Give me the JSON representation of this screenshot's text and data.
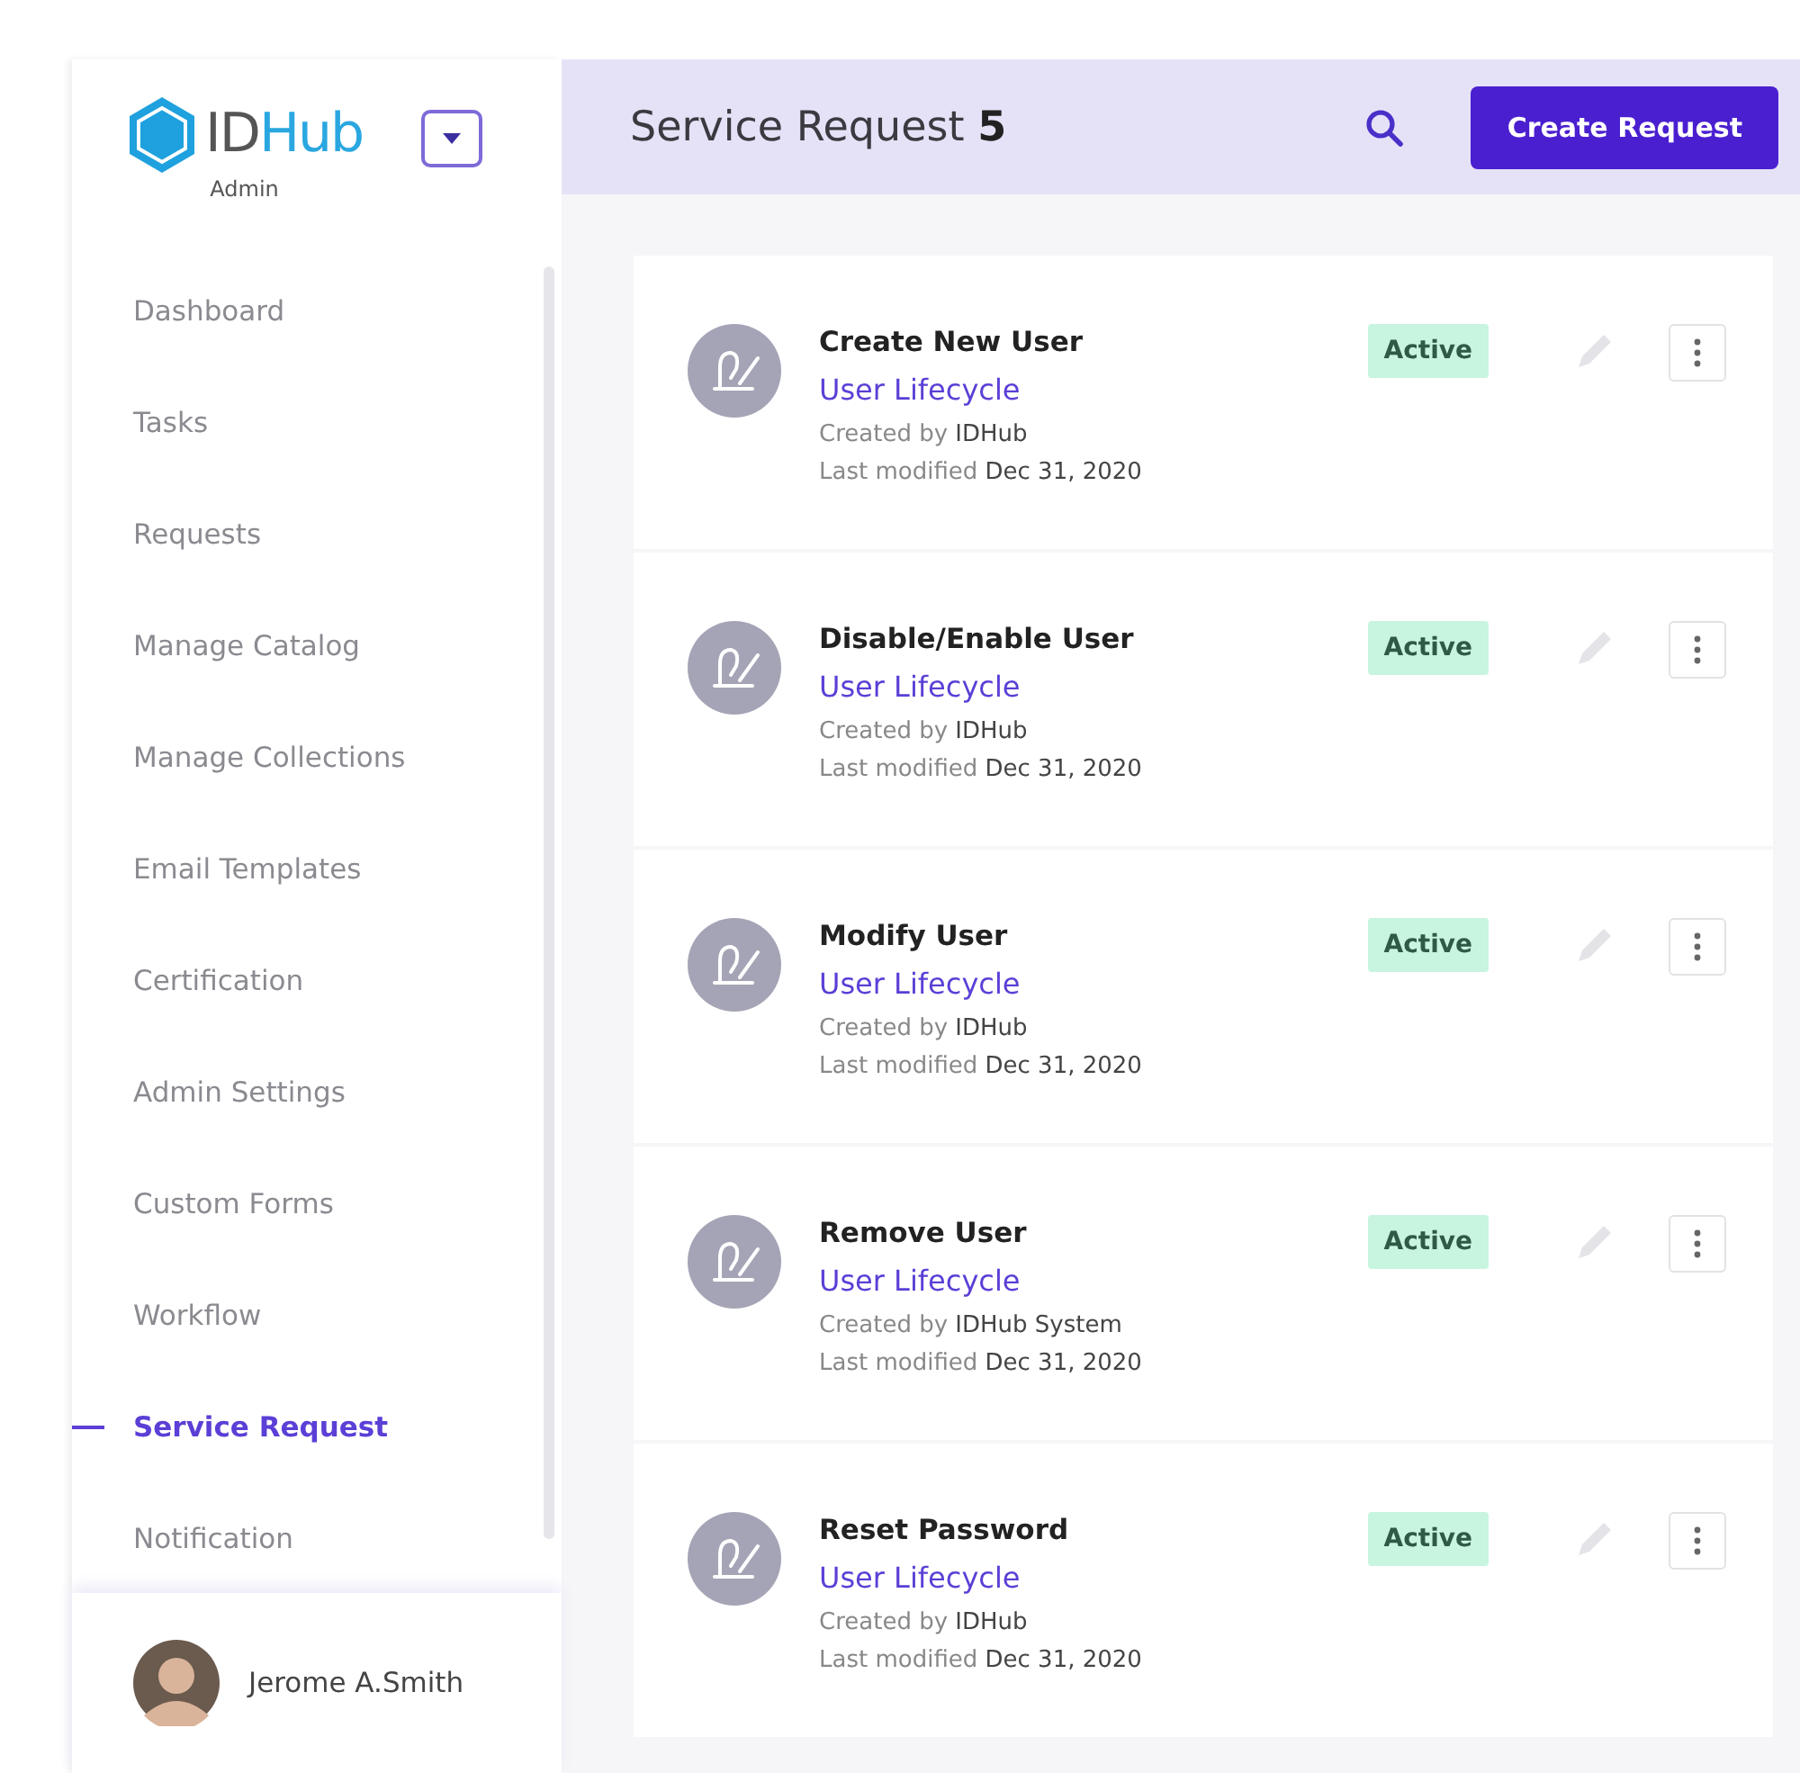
{
  "brand": {
    "name_dark": "ID",
    "name_light": "Hub",
    "subtitle": "Admin"
  },
  "sidebar": {
    "items": [
      {
        "label": "Dashboard",
        "selected": false
      },
      {
        "label": "Tasks",
        "selected": false
      },
      {
        "label": "Requests",
        "selected": false
      },
      {
        "label": "Manage Catalog",
        "selected": false
      },
      {
        "label": "Manage Collections",
        "selected": false
      },
      {
        "label": "Email Templates",
        "selected": false
      },
      {
        "label": "Certification",
        "selected": false
      },
      {
        "label": "Admin Settings",
        "selected": false
      },
      {
        "label": "Custom Forms",
        "selected": false
      },
      {
        "label": "Workflow",
        "selected": false
      },
      {
        "label": "Service Request",
        "selected": true
      },
      {
        "label": "Notification",
        "selected": false
      }
    ],
    "user": {
      "name": "Jerome A.Smith"
    }
  },
  "header": {
    "title": "Service Request **5**",
    "button": "Create Request"
  },
  "requests": [
    {
      "title": "Create New User",
      "category": "User Lifecycle",
      "created": "Created by **IDHub**",
      "modified": "Last modified **Dec 31, 2020**",
      "status": "Active"
    },
    {
      "title": "Disable/Enable User",
      "category": "User Lifecycle",
      "created": "Created by **IDHub**",
      "modified": "Last modified **Dec 31, 2020**",
      "status": "Active"
    },
    {
      "title": "Modify User",
      "category": "User Lifecycle",
      "created": "Created by **IDHub**",
      "modified": "Last modified **Dec 31, 2020**",
      "status": "Active"
    },
    {
      "title": "Remove User",
      "category": "User Lifecycle",
      "created": "Created by **IDHub System**",
      "modified": "Last modified **Dec 31, 2020**",
      "status": "Active"
    },
    {
      "title": "Reset Password",
      "category": "User Lifecycle",
      "created": "Created by **IDHub**",
      "modified": "Last modified **Dec 31, 2020**",
      "status": "Active"
    }
  ]
}
